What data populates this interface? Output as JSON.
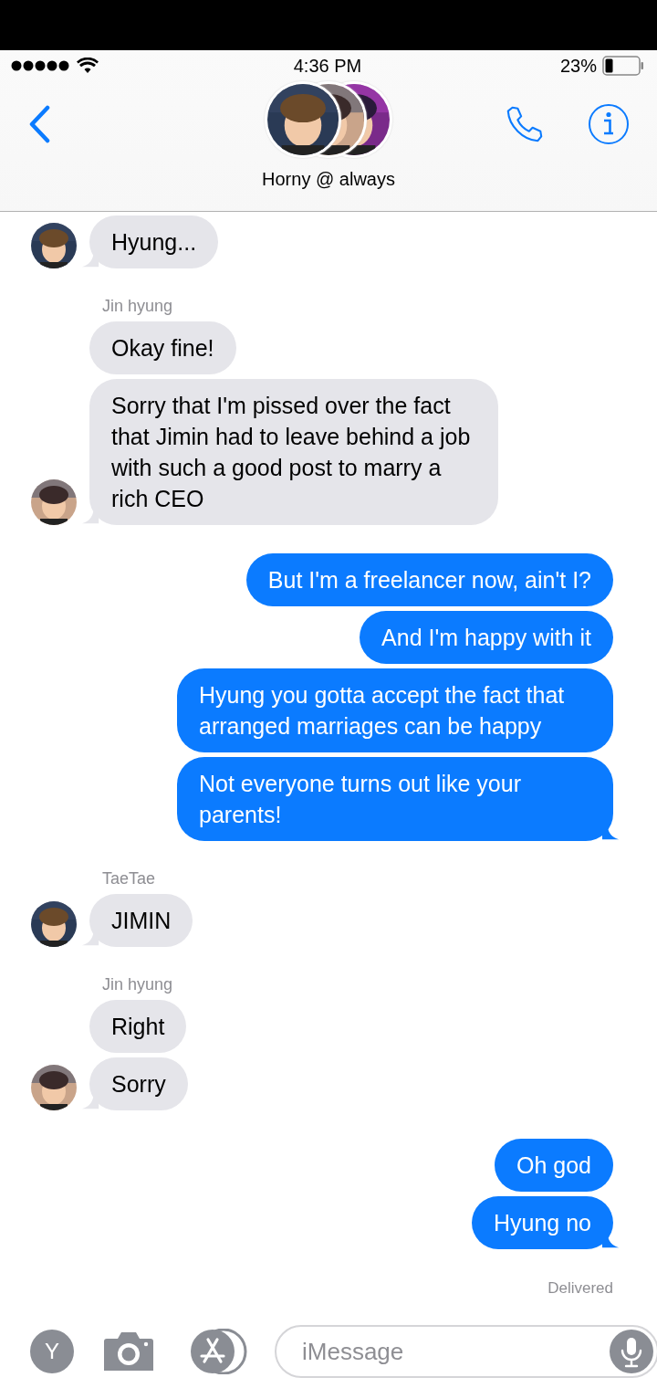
{
  "status_bar": {
    "time": "4:36 PM",
    "battery": "23%"
  },
  "header": {
    "title": "Horny @ always"
  },
  "groups": [
    {
      "kind": "received",
      "messages": [
        "Hyung..."
      ]
    },
    {
      "kind": "received",
      "sender": "Jin hyung",
      "messages": [
        "Okay fine!",
        "Sorry that I'm pissed over the fact that Jimin had to leave behind a job with such a good post to marry a rich CEO"
      ]
    },
    {
      "kind": "sent",
      "messages": [
        "But I'm a freelancer now, ain't I?",
        "And I'm happy with it",
        "Hyung you gotta accept the fact that arranged marriages can be happy",
        "Not everyone turns out like your parents!"
      ]
    },
    {
      "kind": "received",
      "sender": "TaeTae",
      "messages": [
        "JIMIN"
      ]
    },
    {
      "kind": "received",
      "sender": "Jin hyung",
      "messages": [
        "Right",
        "Sorry"
      ]
    },
    {
      "kind": "sent",
      "messages": [
        "Oh god",
        "Hyung no"
      ]
    }
  ],
  "delivery_status": "Delivered",
  "composer": {
    "apps_button": "Y",
    "placeholder": "iMessage"
  }
}
